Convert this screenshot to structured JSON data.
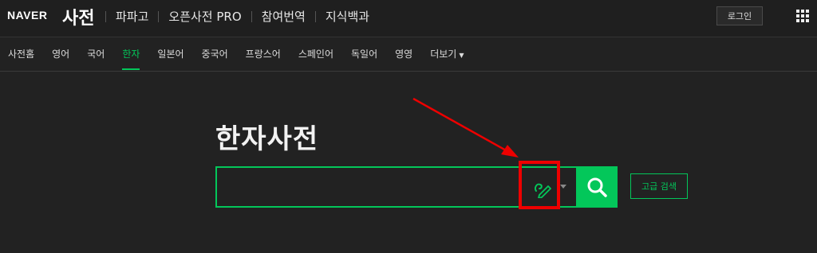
{
  "header": {
    "logo": "NAVER",
    "service": "사전",
    "links": [
      "파파고",
      "오픈사전 PRO",
      "참여번역",
      "지식백과"
    ],
    "login_label": "로그인"
  },
  "nav": {
    "items": [
      {
        "label": "사전홈",
        "active": false
      },
      {
        "label": "영어",
        "active": false
      },
      {
        "label": "국어",
        "active": false
      },
      {
        "label": "한자",
        "active": true
      },
      {
        "label": "일본어",
        "active": false
      },
      {
        "label": "중국어",
        "active": false
      },
      {
        "label": "프랑스어",
        "active": false
      },
      {
        "label": "스페인어",
        "active": false
      },
      {
        "label": "독일어",
        "active": false
      },
      {
        "label": "영영",
        "active": false
      }
    ],
    "more_label": "더보기"
  },
  "main": {
    "title": "한자사전",
    "search_value": "",
    "advanced_label": "고급 검색"
  },
  "colors": {
    "accent": "#03c75a",
    "annotation": "#e00000",
    "background": "#222222"
  },
  "icons": {
    "handwrite": "handwriting-pen-icon",
    "search": "search-icon",
    "apps": "grid-icon"
  }
}
